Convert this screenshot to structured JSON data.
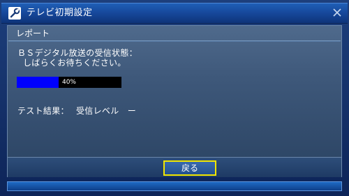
{
  "window": {
    "title": "テレビ初期設定",
    "icon": "wrench-icon",
    "accent_color": "#1f5fb6"
  },
  "report": {
    "section_title": "レポート",
    "status_line1": "ＢＳデジタル放送の受信状態：",
    "status_line2": "しばらくお待ちください。",
    "progress": {
      "value_percent": 40,
      "label": "40%",
      "fill_color": "#0000ff"
    },
    "result_label": "テスト結果：",
    "result_value": "受信レベル　ー"
  },
  "footer": {
    "back_label": "戻る",
    "focus_color": "#f2e600"
  }
}
